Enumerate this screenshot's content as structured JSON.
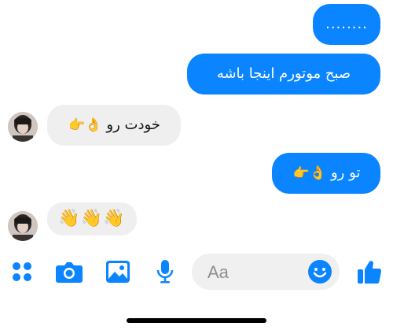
{
  "messages": [
    {
      "direction": "outgoing",
      "text": "........"
    },
    {
      "direction": "outgoing",
      "text": "صبح موتورم اینجا باشه"
    },
    {
      "direction": "incoming",
      "text": "خودت رو",
      "emojis": "👌👉"
    },
    {
      "direction": "outgoing",
      "text": "تو رو",
      "emojis": "👌👉"
    },
    {
      "direction": "incoming",
      "text": "",
      "emojis": "👋👋👋"
    }
  ],
  "composer": {
    "placeholder": "Aa"
  },
  "toolbar": {
    "icons": [
      "apps-icon",
      "camera-icon",
      "gallery-icon",
      "microphone-icon",
      "emoji-icon",
      "like-icon"
    ]
  },
  "colors": {
    "accent": "#0a84ff",
    "incoming_bubble": "#efefef",
    "background": "#ffffff"
  }
}
